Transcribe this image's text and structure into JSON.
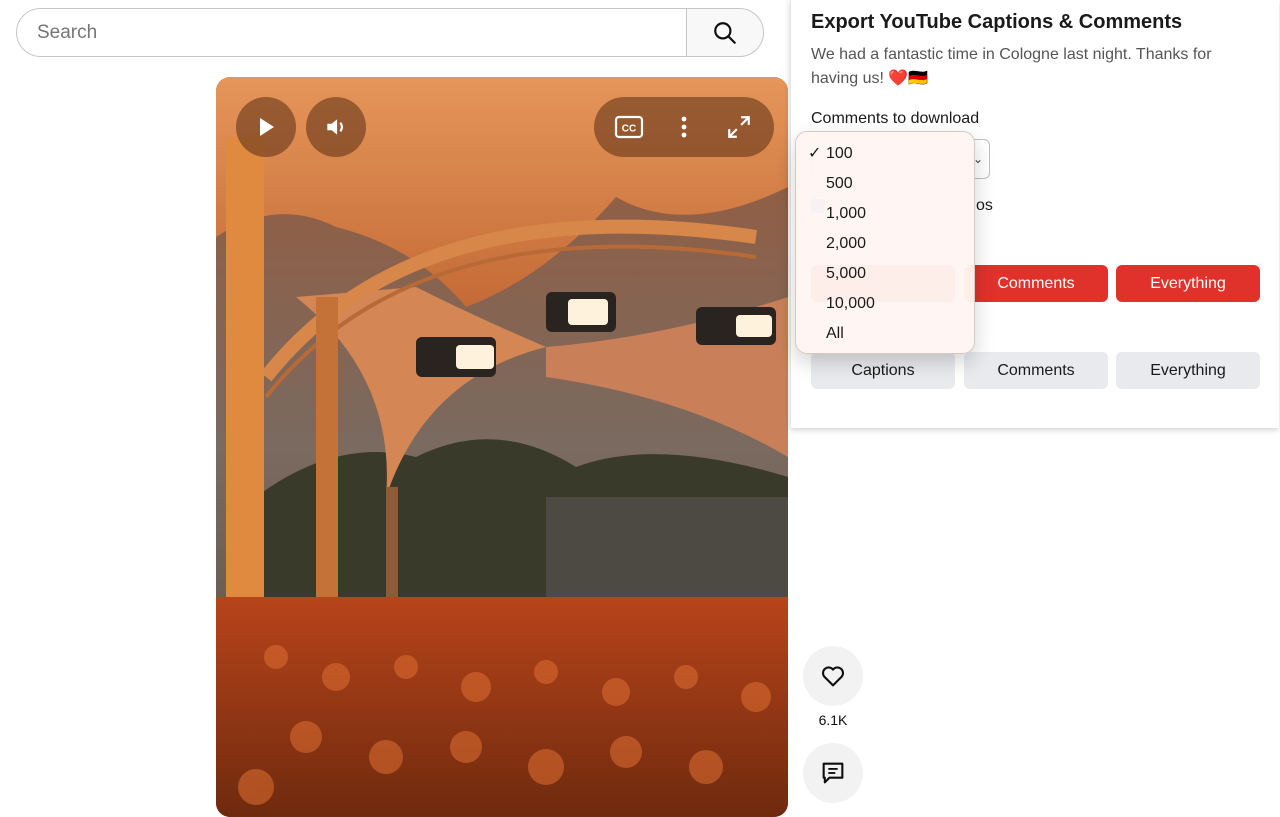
{
  "search": {
    "placeholder": "Search"
  },
  "video": {
    "controls": {
      "play": "play-icon",
      "volume": "volume-icon",
      "cc": "CC",
      "more": "more-vert-icon",
      "fullscreen": "fullscreen-icon"
    }
  },
  "actions": {
    "like_count": "6.1K"
  },
  "popup": {
    "title": "Export YouTube Captions & Comments",
    "description": "We had a fantastic time in Cologne last night. Thanks for having us! ❤️🇩🇪",
    "comments_label": "Comments to download",
    "timestamps_partial": "os",
    "download_buttons": {
      "comments": "Comments",
      "everything": "Everything"
    },
    "copy_buttons": {
      "captions": "Captions",
      "comments": "Comments",
      "everything": "Everything"
    }
  },
  "dropdown": {
    "selected": "100",
    "options": [
      "100",
      "500",
      "1,000",
      "2,000",
      "5,000",
      "10,000",
      "All"
    ]
  },
  "colors": {
    "accent_red": "#e0312b",
    "gray_button": "#e9eaee"
  }
}
